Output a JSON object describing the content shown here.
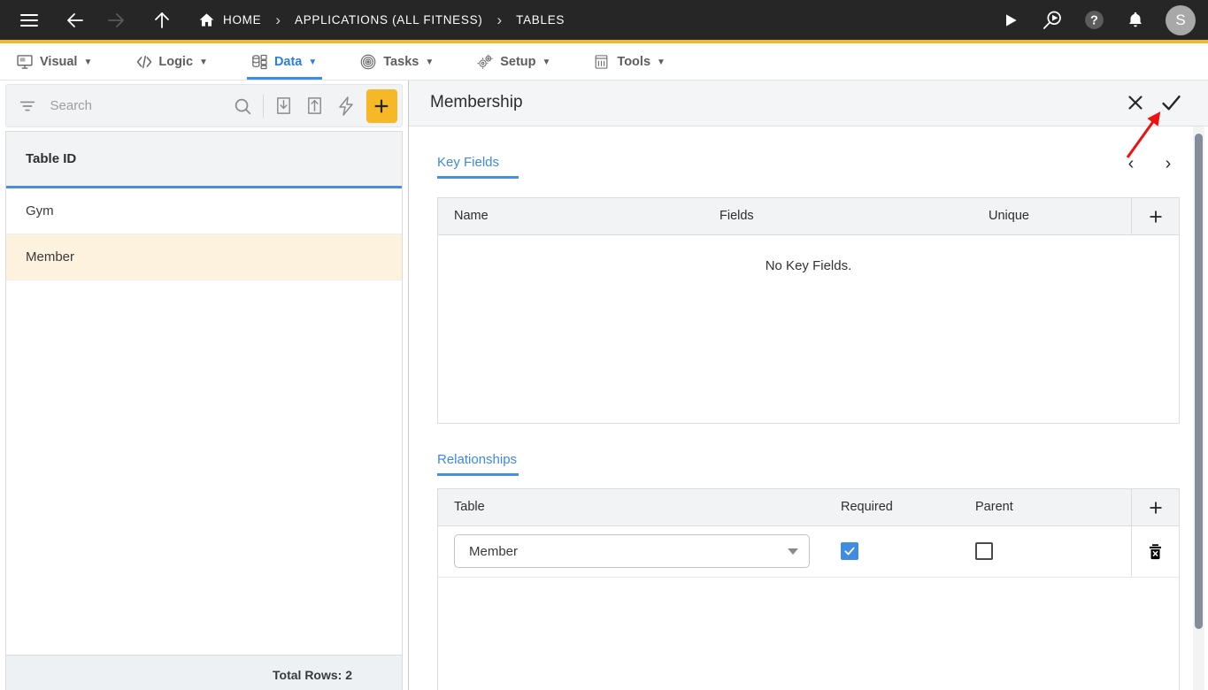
{
  "topbar": {
    "icons": {
      "menu": "hamburger-menu-icon",
      "back": "back-arrow-icon",
      "forward": "forward-arrow-icon",
      "up": "up-arrow-icon",
      "run": "play-icon",
      "search_run": "magnifier-play-icon",
      "help": "help-icon",
      "notifications": "bell-icon"
    },
    "breadcrumbs": [
      {
        "label": "HOME",
        "icon": "home-icon"
      },
      {
        "label": "APPLICATIONS (ALL FITNESS)"
      },
      {
        "label": "TABLES"
      }
    ],
    "separator": "›",
    "avatar_initial": "S",
    "background": "#262626",
    "accent": "#f5b820"
  },
  "menubar": {
    "items": [
      {
        "label": "Visual",
        "icon": "monitor-icon",
        "caret": "▼",
        "active": false
      },
      {
        "label": "Logic",
        "icon": "code-icon",
        "caret": "▼",
        "active": false
      },
      {
        "label": "Data",
        "icon": "database-icon",
        "caret": "▼",
        "active": true
      },
      {
        "label": "Tasks",
        "icon": "target-icon",
        "caret": "▼",
        "active": false
      },
      {
        "label": "Setup",
        "icon": "gears-icon",
        "caret": "▼",
        "active": false
      },
      {
        "label": "Tools",
        "icon": "toolbox-icon",
        "caret": "▼",
        "active": false
      }
    ],
    "active_color": "#2f7de1"
  },
  "sidebar": {
    "search": {
      "placeholder": "Search",
      "value": ""
    },
    "toolbar": {
      "filter": "filter-icon",
      "search": "search-icon",
      "import": "import-icon",
      "export": "export-icon",
      "bolt": "lightning-bolt-icon",
      "add": "plus-icon"
    },
    "table": {
      "column_header": "Table ID",
      "rows": [
        {
          "name": "Gym",
          "selected": false
        },
        {
          "name": "Member",
          "selected": true
        }
      ],
      "footer": "Total Rows: 2"
    },
    "selected_row_color": "#fcf2dd"
  },
  "detail": {
    "title": "Membership",
    "header_actions": {
      "cancel": "close-x-icon",
      "save": "checkmark-icon"
    },
    "key_fields": {
      "label": "Key Fields",
      "pager": {
        "prev": "‹",
        "next": "›"
      },
      "columns": [
        "Name",
        "Fields",
        "Unique"
      ],
      "add_label": "+",
      "empty_message": "No Key Fields.",
      "rows": []
    },
    "relationships": {
      "label": "Relationships",
      "columns": [
        "Table",
        "Required",
        "Parent"
      ],
      "add_label": "+",
      "rows": [
        {
          "table": "Member",
          "required": true,
          "parent": false,
          "delete_icon": "trash-icon"
        }
      ]
    },
    "annotation": {
      "type": "red-arrow",
      "color": "#ee1111",
      "points_to": "checkmark-icon"
    }
  }
}
